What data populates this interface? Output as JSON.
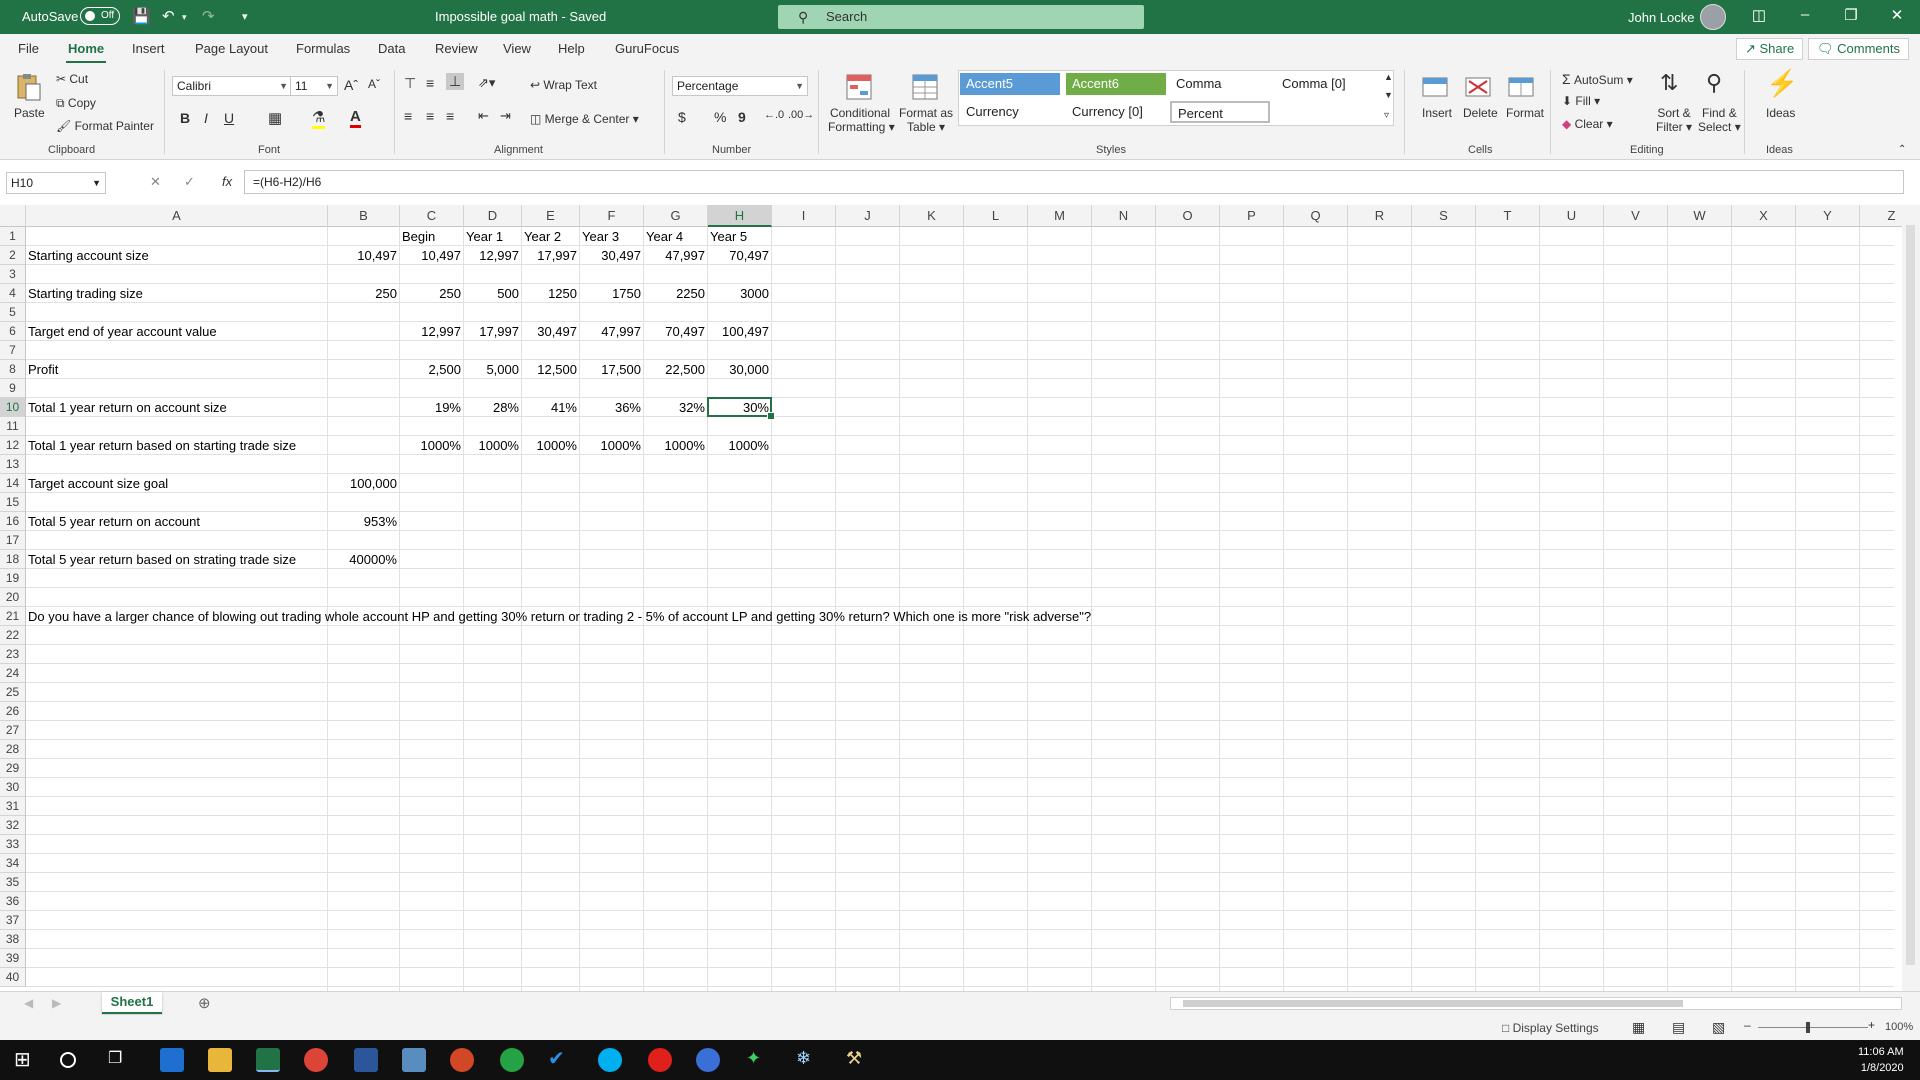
{
  "titlebar": {
    "autosave_label": "AutoSave",
    "autosave_state": "Off",
    "document_title": "Impossible goal math  -  Saved",
    "search_placeholder": "Search",
    "user_name": "John Locke"
  },
  "ribbon_tabs": [
    "File",
    "Home",
    "Insert",
    "Page Layout",
    "Formulas",
    "Data",
    "Review",
    "View",
    "Help",
    "GuruFocus"
  ],
  "active_tab": "Home",
  "share_label": "Share",
  "comments_label": "Comments",
  "clipboard": {
    "paste": "Paste",
    "cut": "Cut",
    "copy": "Copy",
    "format_painter": "Format Painter",
    "group": "Clipboard"
  },
  "font": {
    "name": "Calibri",
    "size": "11",
    "bold": "B",
    "italic": "I",
    "underline": "U",
    "group": "Font"
  },
  "alignment": {
    "wrap_text": "Wrap Text",
    "merge_center": "Merge & Center",
    "group": "Alignment"
  },
  "number": {
    "format": "Percentage",
    "currency_symbol": "$",
    "percent_symbol": "%",
    "comma_symbol": "9",
    "group": "Number"
  },
  "styles": {
    "conditional_formatting_1": "Conditional",
    "conditional_formatting_2": "Formatting",
    "format_as_table_1": "Format as",
    "format_as_table_2": "Table",
    "cells": [
      "Accent5",
      "Accent6",
      "Comma",
      "Comma [0]",
      "Currency",
      "Currency [0]",
      "Percent"
    ],
    "group": "Styles"
  },
  "cells_group": {
    "insert": "Insert",
    "delete": "Delete",
    "format": "Format",
    "group": "Cells"
  },
  "editing": {
    "autosum": "AutoSum",
    "fill": "Fill",
    "clear": "Clear",
    "sort_filter_1": "Sort &",
    "sort_filter_2": "Filter",
    "find_select_1": "Find &",
    "find_select_2": "Select",
    "group": "Editing"
  },
  "ideas": {
    "label": "Ideas",
    "group": "Ideas"
  },
  "formula_bar": {
    "name_box": "H10",
    "fx": "fx",
    "formula": "=(H6-H2)/H6"
  },
  "columns": [
    "A",
    "B",
    "C",
    "D",
    "E",
    "F",
    "G",
    "H",
    "I",
    "J",
    "K",
    "L",
    "M",
    "N",
    "O",
    "P",
    "Q",
    "R",
    "S",
    "T",
    "U",
    "V",
    "W",
    "X",
    "Y",
    "Z"
  ],
  "rows_count": 40,
  "sheet": {
    "r1": {
      "C": "Begin",
      "D": "Year 1",
      "E": "Year 2",
      "F": "Year 3",
      "G": "Year 4",
      "H": "Year 5"
    },
    "r2": {
      "A": "Starting account size",
      "B": "10,497",
      "C": "10,497",
      "D": "12,997",
      "E": "17,997",
      "F": "30,497",
      "G": "47,997",
      "H": "70,497"
    },
    "r4": {
      "A": "Starting trading size",
      "B": "250",
      "C": "250",
      "D": "500",
      "E": "1250",
      "F": "1750",
      "G": "2250",
      "H": "3000"
    },
    "r6": {
      "A": "Target end of year account value",
      "C": "12,997",
      "D": "17,997",
      "E": "30,497",
      "F": "47,997",
      "G": "70,497",
      "H": "100,497"
    },
    "r8": {
      "A": "Profit",
      "C": "2,500",
      "D": "5,000",
      "E": "12,500",
      "F": "17,500",
      "G": "22,500",
      "H": "30,000"
    },
    "r10": {
      "A": "Total 1 year return on account size",
      "C": "19%",
      "D": "28%",
      "E": "41%",
      "F": "36%",
      "G": "32%",
      "H": "30%"
    },
    "r12": {
      "A": "Total 1 year return based on starting trade size",
      "C": "1000%",
      "D": "1000%",
      "E": "1000%",
      "F": "1000%",
      "G": "1000%",
      "H": "1000%"
    },
    "r14": {
      "A": "Target account size goal",
      "B": "100,000"
    },
    "r16": {
      "A": "Total 5 year return on account",
      "B": "953%"
    },
    "r18": {
      "A": "Total 5 year return based on strating trade size",
      "B": "40000%"
    },
    "r21": {
      "A": "Do you have a larger chance of blowing out trading whole account HP and getting 30% return or trading 2 - 5% of account LP and getting 30% return?  Which one is more \"risk adverse\"?"
    }
  },
  "sheet_tab": "Sheet1",
  "status": {
    "display_settings": "Display Settings",
    "zoom": "100%"
  },
  "clock": {
    "time": "11:06 AM",
    "date": "1/8/2020"
  },
  "colors": {
    "excel_green": "#217346",
    "accent5": "#4472C4",
    "accent6": "#70AD47"
  }
}
